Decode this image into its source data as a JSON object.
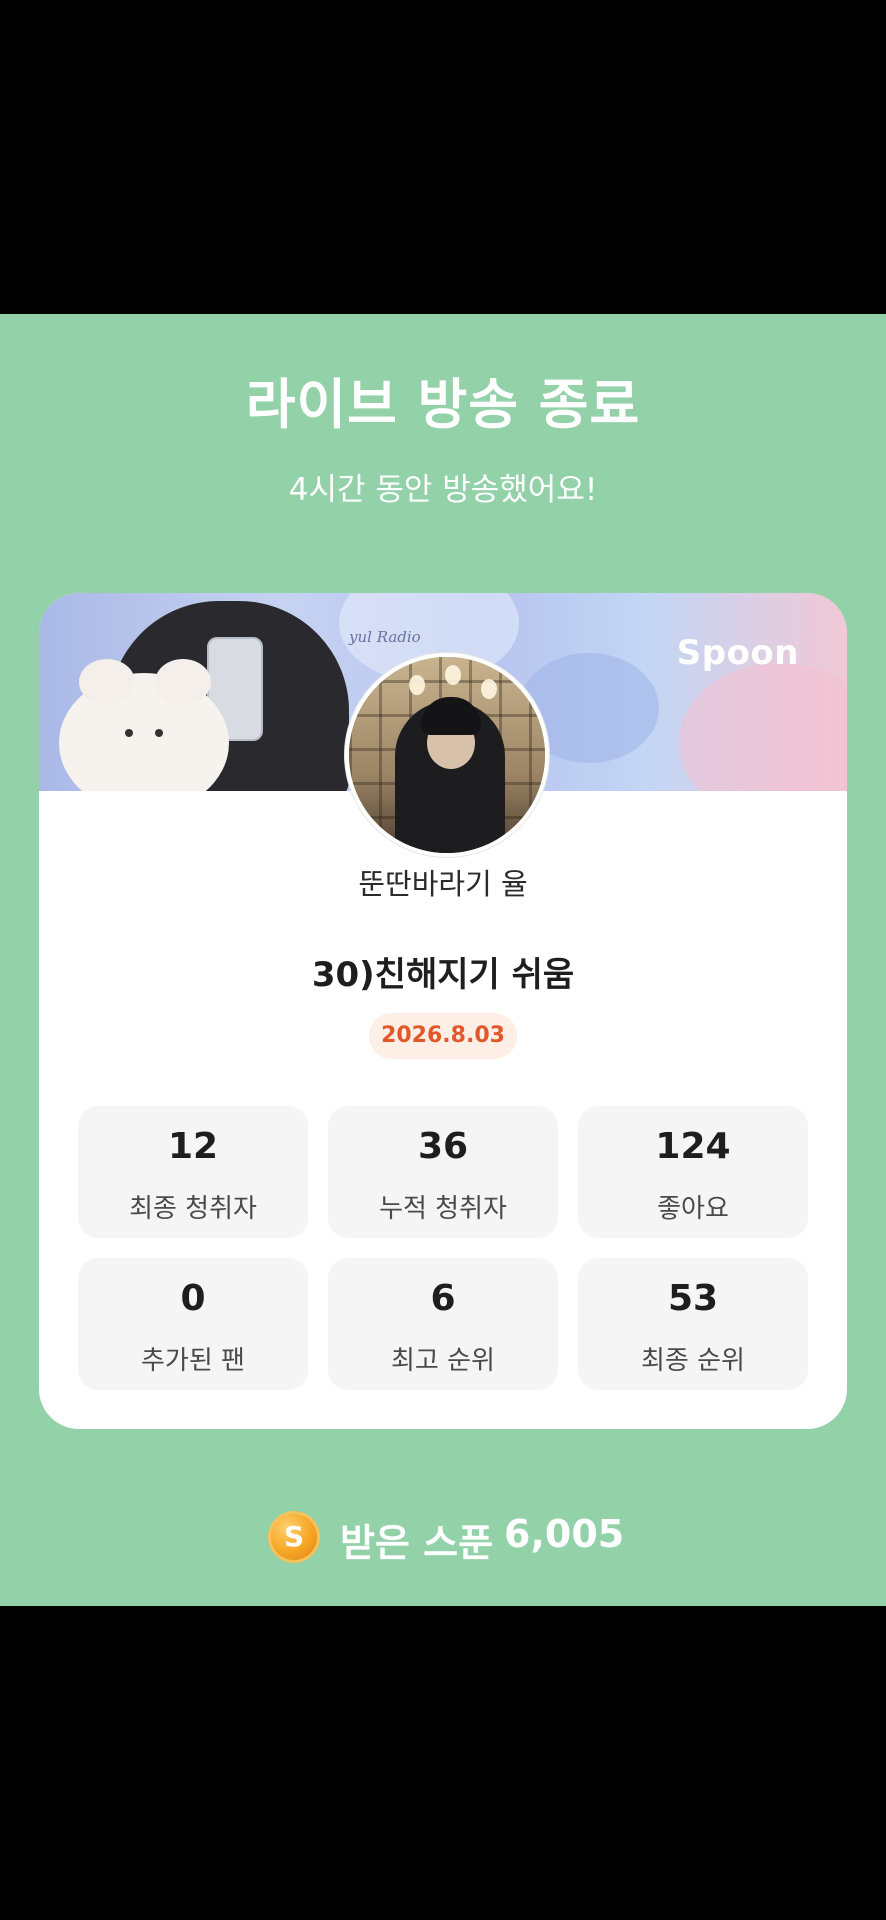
{
  "header": {
    "title": "라이브 방송 종료",
    "subtitle": "4시간 동안 방송했어요!"
  },
  "card": {
    "banner_script": "yul Radio",
    "brand_logo": "Spoon",
    "avatar_icon": "profile-photo",
    "nickname": "뚠딴바라기 율",
    "live_title": "30)친해지기 쉬움",
    "date": "2026.8.03",
    "date_color": "#e0592a"
  },
  "stats": [
    {
      "value": "12",
      "label": "최종 청취자"
    },
    {
      "value": "36",
      "label": "누적 청취자"
    },
    {
      "value": "124",
      "label": "좋아요"
    },
    {
      "value": "0",
      "label": "추가된 팬"
    },
    {
      "value": "6",
      "label": "최고 순위"
    },
    {
      "value": "53",
      "label": "최종 순위"
    }
  ],
  "spoons": {
    "icon": "spoon-coin-icon",
    "icon_glyph": "S",
    "label": "받은 스푼",
    "value": "6,005"
  },
  "colors": {
    "background": "#93d1a9",
    "card": "#ffffff",
    "stat_box": "#f5f5f5",
    "accent": "#e0592a",
    "coin": "#f5a623"
  }
}
